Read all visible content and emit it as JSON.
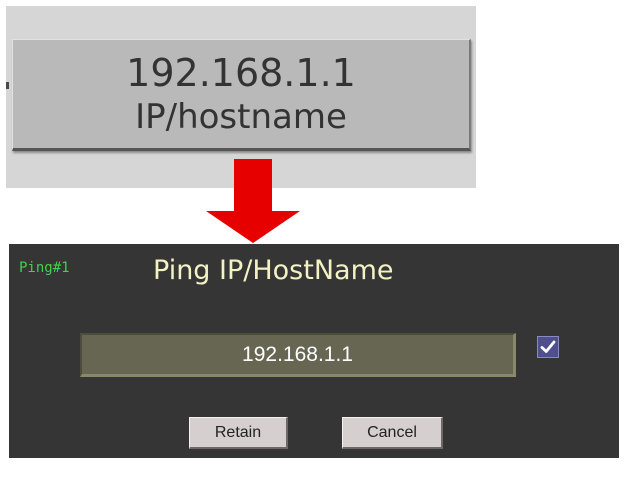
{
  "tile": {
    "ip": "192.168.1.1",
    "label": "IP/hostname"
  },
  "dialog": {
    "id_label": "Ping#1",
    "title": "Ping IP/HostName",
    "input_value": "192.168.1.1",
    "checkbox_checked": true,
    "retain_label": "Retain",
    "cancel_label": "Cancel"
  },
  "icons": {
    "arrow": "arrow-down-icon",
    "check": "checkmark-icon"
  },
  "colors": {
    "arrow": "#e60000",
    "title_text": "#f2f2c4",
    "id_text": "#3fd24c",
    "checkbox_bg": "#4f4f8e"
  }
}
